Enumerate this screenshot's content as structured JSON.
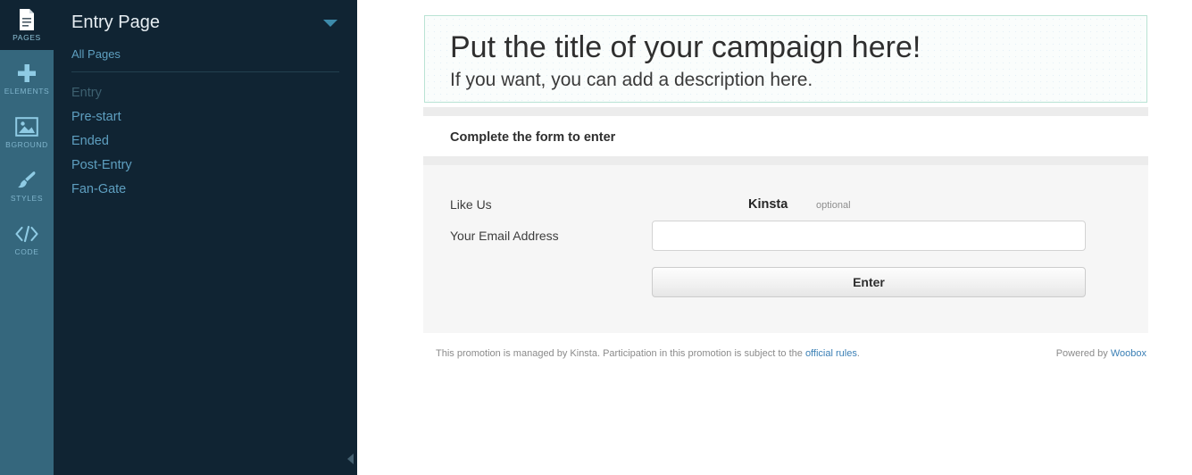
{
  "rail": {
    "items": [
      {
        "label": "PAGES",
        "icon": "document-icon",
        "active": true
      },
      {
        "label": "ELEMENTS",
        "icon": "plus-icon",
        "active": false
      },
      {
        "label": "BGROUND",
        "icon": "image-icon",
        "active": false
      },
      {
        "label": "STYLES",
        "icon": "brush-icon",
        "active": false
      },
      {
        "label": "CODE",
        "icon": "code-icon",
        "active": false
      }
    ]
  },
  "panel": {
    "title": "Entry Page",
    "caret_icon": "chevron-down-icon",
    "all_pages_label": "All Pages",
    "collapse_icon": "chevron-left-icon",
    "pages": [
      {
        "label": "Entry",
        "current": true
      },
      {
        "label": "Pre-start",
        "current": false
      },
      {
        "label": "Ended",
        "current": false
      },
      {
        "label": "Post-Entry",
        "current": false
      },
      {
        "label": "Fan-Gate",
        "current": false
      }
    ]
  },
  "canvas": {
    "header": {
      "title": "Put the title of your campaign here!",
      "description": "If you want, you can add a description here."
    },
    "form_heading": "Complete the form to enter",
    "fields": {
      "like": {
        "label": "Like Us",
        "brand": "Kinsta",
        "optional": "optional"
      },
      "email": {
        "label": "Your Email Address",
        "value": "",
        "placeholder": ""
      }
    },
    "submit_label": "Enter",
    "footer": {
      "legal_prefix": "This promotion is managed by Kinsta. Participation in this promotion is subject to the ",
      "legal_link": "official rules",
      "legal_suffix": ".",
      "powered_prefix": "Powered by ",
      "powered_link": "Woobox"
    }
  },
  "colors": {
    "rail_bg": "#35677d",
    "rail_active_bg": "#102433",
    "panel_bg": "#102433",
    "link_blue": "#5e9fc0",
    "header_border": "#b9e3d4",
    "form_bg": "#f6f6f6"
  }
}
